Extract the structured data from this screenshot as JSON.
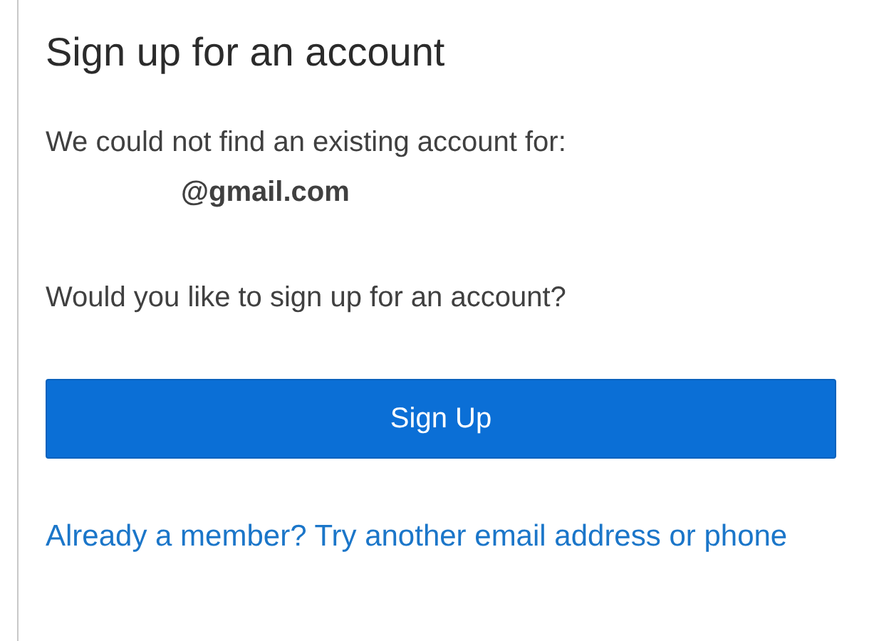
{
  "title": "Sign up for an account",
  "message": "We could not find an existing account for:",
  "email": "@gmail.com",
  "question": "Would you like to sign up for an account?",
  "button": "Sign Up",
  "link": "Already a member? Try another email address or phone"
}
